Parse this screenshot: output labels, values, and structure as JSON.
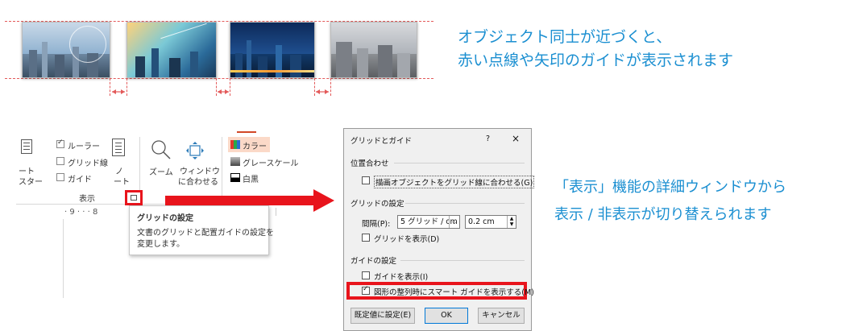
{
  "headline": {
    "line1": "オブジェクト同士が近づくと、",
    "line2": "赤い点線や矢印のガイドが表示されます"
  },
  "ribbon": {
    "left_label_1": "ート",
    "left_label_2": "スター",
    "ruler_label": "ルーラー",
    "gridlines_label": "グリッド線",
    "guides_label": "ガイド",
    "show_group_label": "表示",
    "notes_label_1": "ノ",
    "notes_label_2": "ート",
    "zoom_label": "ズーム",
    "fit_window_label_1": "ウィンドウ",
    "fit_window_label_2": "に合わせる",
    "color_label": "カラー",
    "grayscale_label": "グレースケール",
    "bw_label": "白黒",
    "ruler_ticks": "· 9 · · · 8"
  },
  "tooltip": {
    "title": "グリッドの設定",
    "body_1": "文書のグリッドと配置ガイドの設定を",
    "body_2": "変更します。"
  },
  "dialog": {
    "title": "グリッドとガイド",
    "help": "?",
    "close": "×",
    "snap_section": "位置合わせ",
    "snap_to_grid": "描画オブジェクトをグリッド線に合わせる(G)",
    "grid_section": "グリッドの設定",
    "spacing_label": "間隔(P):",
    "spacing_value": "5 グリッド / cm",
    "spacing_number": "0.2 cm",
    "show_grid": "グリッドを表示(D)",
    "guide_section": "ガイドの設定",
    "show_guides": "ガイドを表示(I)",
    "smart_guides": "図形の整列時にスマート ガイドを表示する(M)",
    "default_button": "既定値に設定(E)",
    "ok_button": "OK",
    "cancel_button": "キャンセル"
  },
  "caption": {
    "line1": "「表示」機能の詳細ウィンドウから",
    "line2": "表示 / 非表示が切り替えられます"
  },
  "colors": {
    "accent_blue": "#1b8fd1",
    "highlight_red": "#e8141c",
    "guide_red": "#e35a5a"
  },
  "icons": [
    "slide-layout-icon",
    "notes-page-icon",
    "zoom-icon",
    "fit-window-icon",
    "dialog-launcher-icon",
    "right-arrow-icon",
    "chevron-down-icon",
    "spinner-icon"
  ]
}
